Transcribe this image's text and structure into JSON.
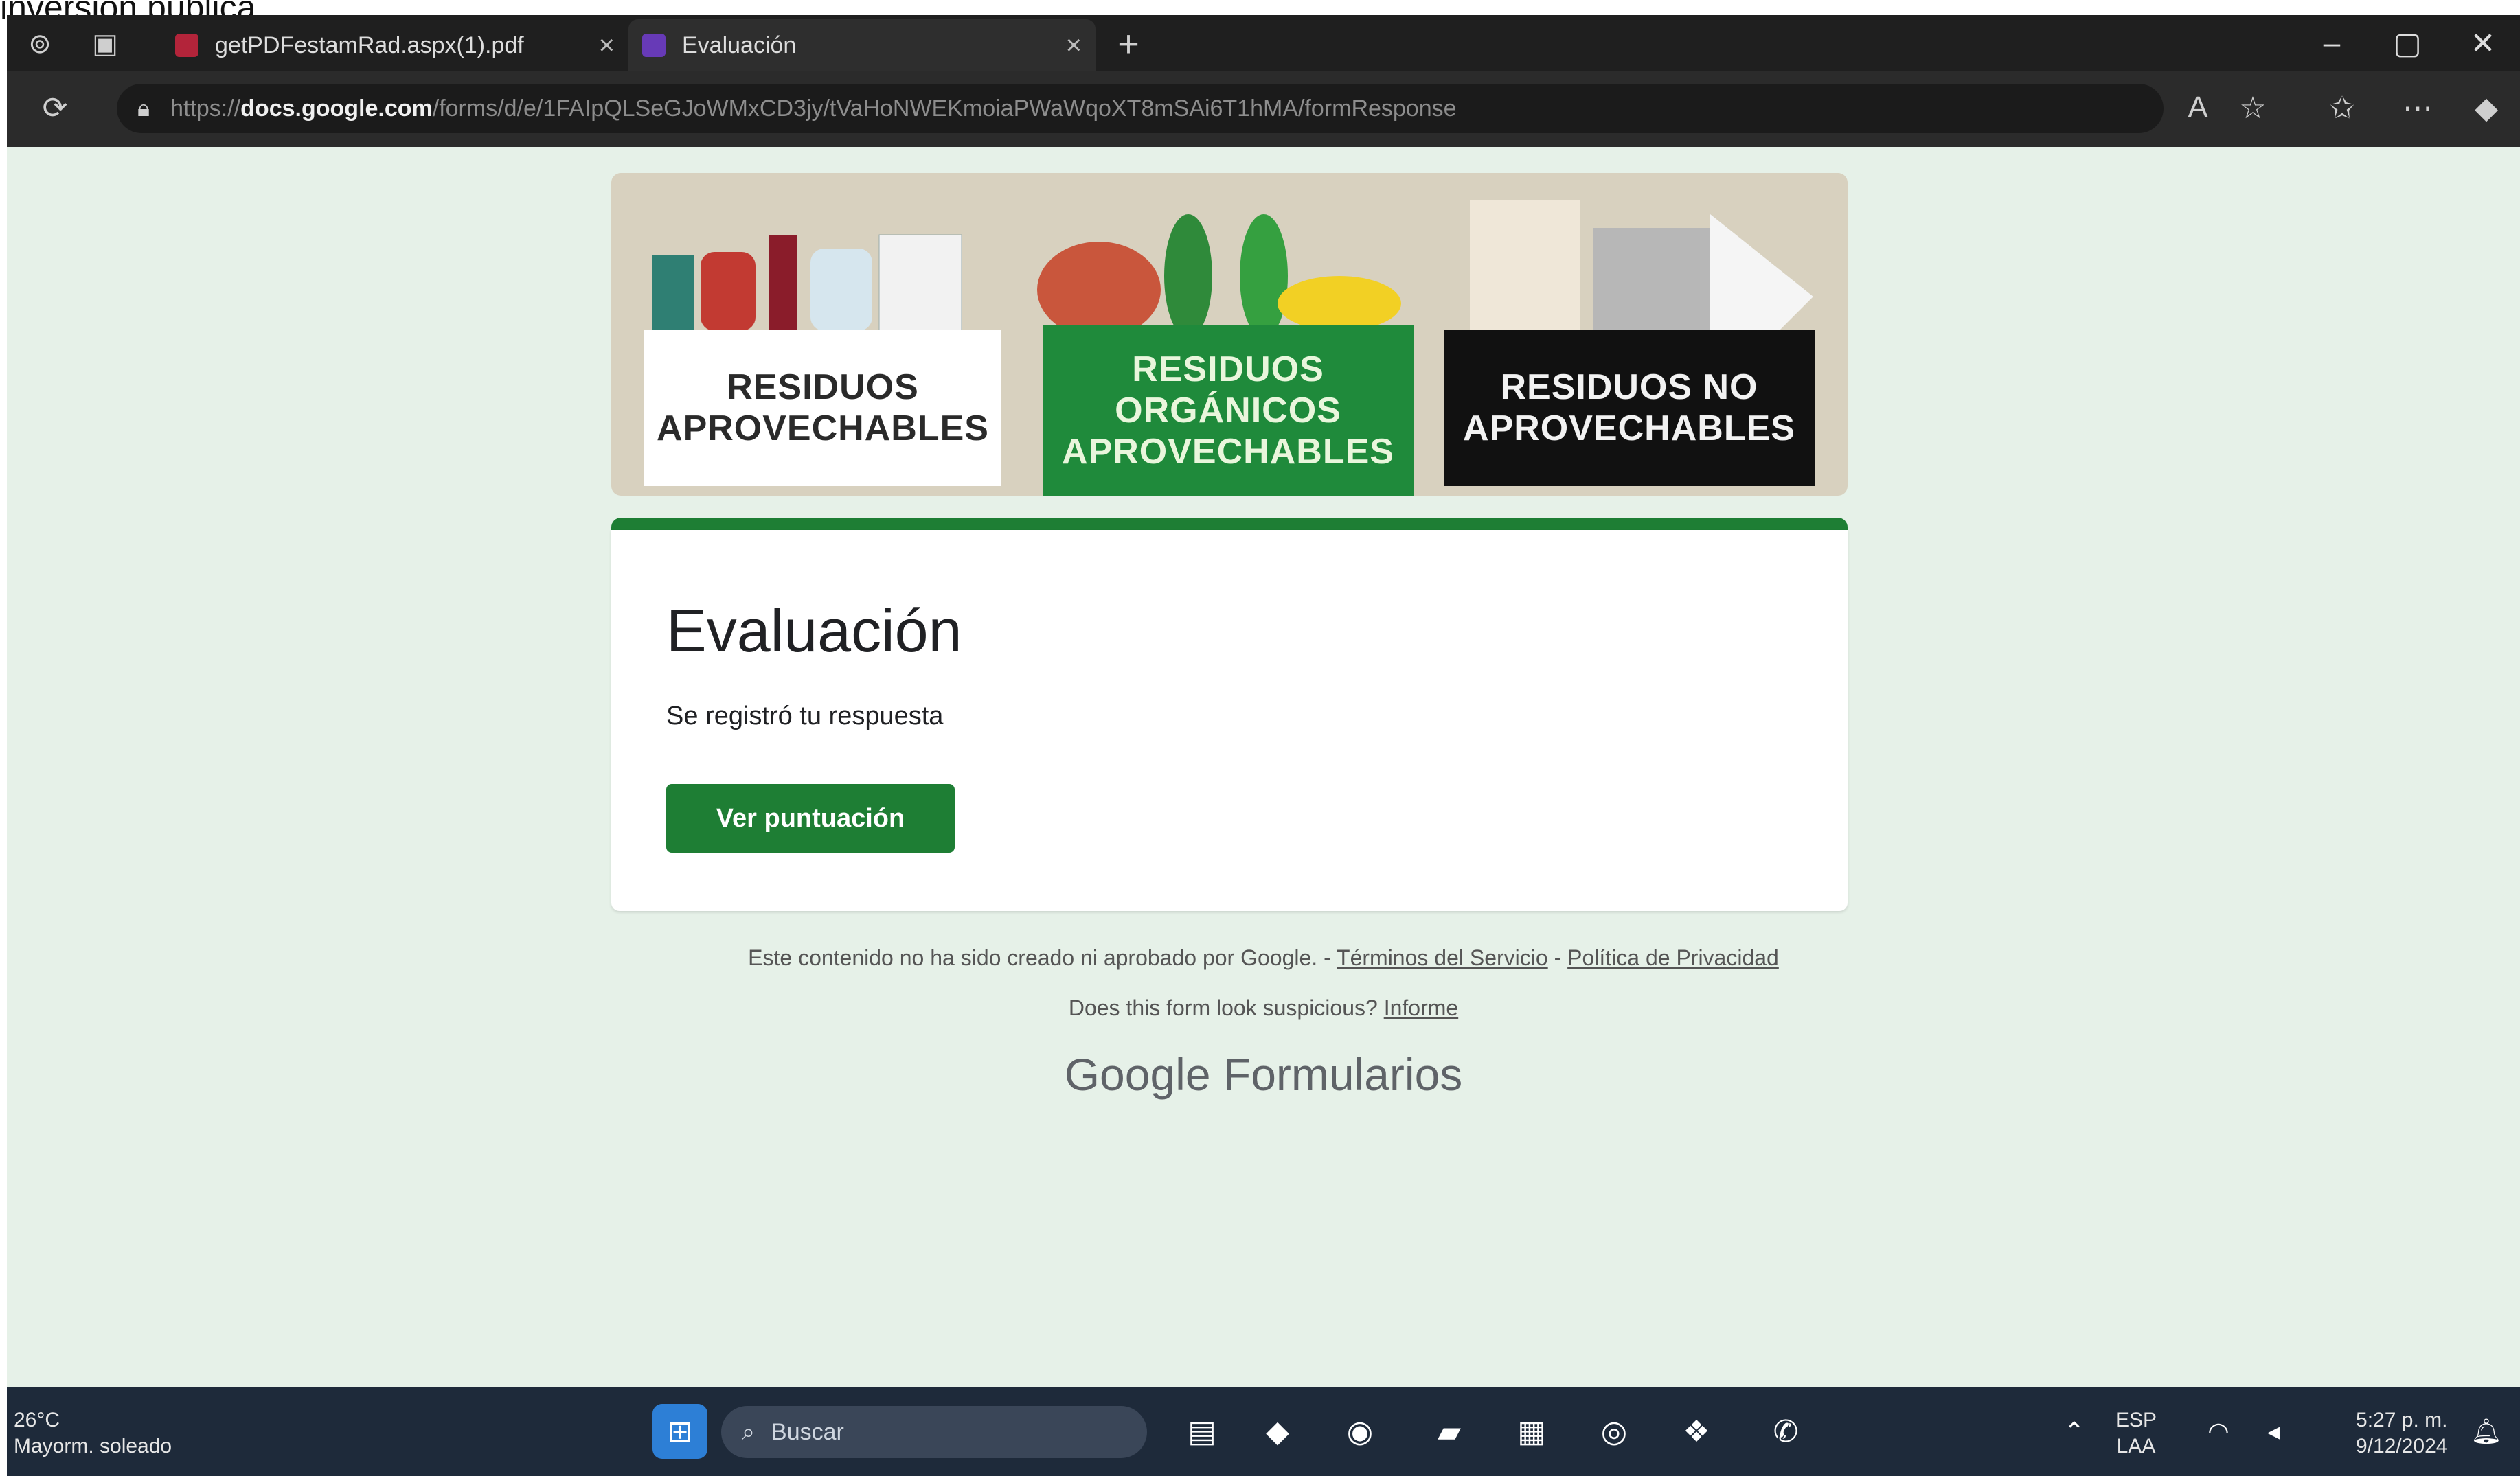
{
  "crop_text": "inversión pública.",
  "browser": {
    "tabs": [
      {
        "label": "getPDFestamRad.aspx(1).pdf",
        "close": "×",
        "favicon_color": "#b3243a"
      },
      {
        "label": "Evaluación",
        "close": "×",
        "favicon_color": "#673ab7"
      }
    ],
    "new_tab": "+",
    "window_controls": [
      "–",
      "▢",
      "✕"
    ],
    "url": {
      "prefix": "https://",
      "host": "docs.google.com",
      "path": "/forms/d/e/1FAIpQLSeGJoWMxCD3jy/tVaHoNWEKmoiaPWaWqoXT8mSAi6T1hMA/formResponse"
    },
    "address_icons": [
      "reload-icon",
      "lock-icon",
      "read-aloud-icon",
      "favorite-icon",
      "favorites-bar-icon",
      "more-icon",
      "copilot-icon"
    ]
  },
  "banner": {
    "bins": [
      {
        "line1": "RESIDUOS",
        "line2": "APROVECHABLES",
        "line3": ""
      },
      {
        "line1": "RESIDUOS",
        "line2": "ORGÁNICOS",
        "line3": "APROVECHABLES"
      },
      {
        "line1": "RESIDUOS NO",
        "line2": "APROVECHABLES",
        "line3": ""
      }
    ]
  },
  "form": {
    "title": "Evaluación",
    "message": "Se registró tu respuesta",
    "button_label": "Ver puntuación",
    "accent_color": "#1e7e34"
  },
  "footer": {
    "disclaimer": "Este contenido no ha sido creado ni aprobado por Google. -",
    "terms_link": "Términos del Servicio",
    "separator": "-",
    "privacy_link": "Política de Privacidad",
    "suspicious_text": "Does this form look suspicious?",
    "report_link": "Informe",
    "brand_google": "Google",
    "brand_product": "Formularios"
  },
  "taskbar": {
    "weather_temp": "26°C",
    "weather_desc": "Mayorm. soleado",
    "search_placeholder": "Buscar",
    "lang_top": "ESP",
    "lang_bottom": "LAA",
    "time": "5:27 p. m.",
    "date": "9/12/2024"
  }
}
